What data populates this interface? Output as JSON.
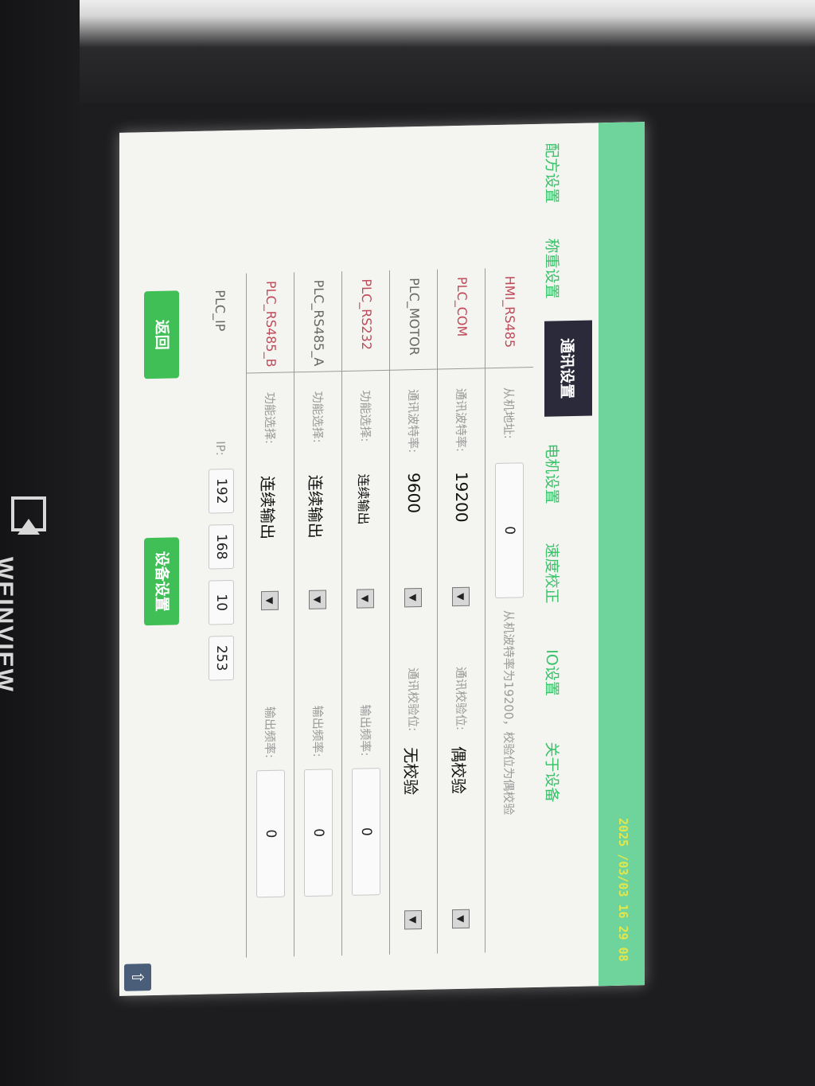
{
  "brand": "WEINVIEW",
  "status": {
    "datetime": "2025 /03/03  16 29 08"
  },
  "nav": {
    "items": [
      "配方设置",
      "称重设置",
      "通讯设置",
      "电机设置",
      "速度校正",
      "IO设置",
      "关于设备"
    ],
    "active": "通讯设置"
  },
  "rows": [
    {
      "name": "HMI_RS485",
      "f1_label": "从机地址:",
      "f1_value": "0",
      "note": "从机波特率为19200，校验位为偶校验"
    },
    {
      "name": "PLC_COM",
      "f1_label": "通讯波特率:",
      "f1_value": "19200",
      "f2_label": "通讯校验位:",
      "f2_value": "偶校验"
    },
    {
      "name": "PLC_MOTOR",
      "f1_label": "通讯波特率:",
      "f1_value": "9600",
      "f2_label": "通讯校验位:",
      "f2_value": "无校验"
    },
    {
      "name": "PLC_RS232",
      "f1_label": "功能选择:",
      "f1_value": "连续输出",
      "f2_label": "输出频率:",
      "f2_value": "0"
    },
    {
      "name": "PLC_RS485_A",
      "f1_label": "功能选择:",
      "f1_value": "连续输出",
      "f2_label": "输出频率:",
      "f2_value": "0"
    },
    {
      "name": "PLC_RS485_B",
      "f1_label": "功能选择:",
      "f1_value": "连续输出",
      "f2_label": "输出频率:",
      "f2_value": "0"
    }
  ],
  "ip": {
    "name": "PLC_IP",
    "label": "IP:",
    "octets": [
      "192",
      "168",
      "10",
      "253"
    ]
  },
  "buttons": {
    "back": "返回",
    "device_settings": "设备设置"
  },
  "icons": {
    "dropdown": "dropdown-arrow-icon",
    "up": "up-arrow-icon"
  },
  "colors": {
    "topbar": "#6fd49b",
    "nav_text": "#3ac26a",
    "nav_active_bg": "#2a2a3a",
    "button": "#3fbf56",
    "datetime": "#e4e64a"
  }
}
